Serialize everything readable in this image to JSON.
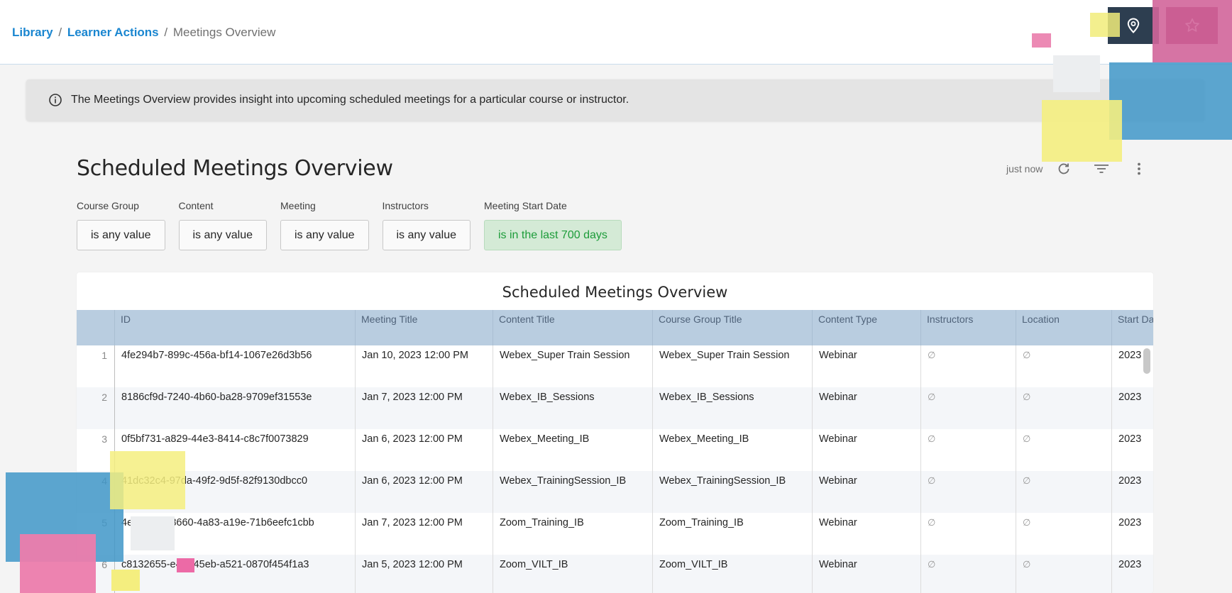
{
  "breadcrumb": {
    "library": "Library",
    "learner_actions": "Learner Actions",
    "current": "Meetings Overview",
    "separator": "/"
  },
  "topbar": {
    "pin_icon": "location-pin-icon",
    "star_icon": "star-icon",
    "pin_button_color": "#2d3e50",
    "star_button_color": "#8f1f52"
  },
  "info_banner": {
    "icon": "info-circle-icon",
    "text": "The Meetings Overview provides insight into upcoming scheduled meetings for a particular course or instructor."
  },
  "dashboard": {
    "title": "Scheduled Meetings Overview",
    "last_updated": "just now",
    "tools": [
      "refresh-icon",
      "filter-icon",
      "more-vertical-icon"
    ]
  },
  "filters": [
    {
      "label": "Course Group",
      "value": "is any value",
      "active": false
    },
    {
      "label": "Content",
      "value": "is any value",
      "active": false
    },
    {
      "label": "Meeting",
      "value": "is any value",
      "active": false
    },
    {
      "label": "Instructors",
      "value": "is any value",
      "active": false
    },
    {
      "label": "Meeting Start Date",
      "value": "is in the last 700 days",
      "active": true
    }
  ],
  "table": {
    "title": "Scheduled Meetings Overview",
    "columns": [
      "",
      "ID",
      "Meeting Title",
      "Content Title",
      "Course Group Title",
      "Content Type",
      "Instructors",
      "Location",
      "Start Da"
    ],
    "rows": [
      [
        "1",
        "4fe294b7-899c-456a-bf14-1067e26d3b56",
        "Jan 10, 2023 12:00 PM",
        "Webex_Super Train Session",
        "Webex_Super Train Session",
        "Webinar",
        "∅",
        "∅",
        "2023"
      ],
      [
        "2",
        "8186cf9d-7240-4b60-ba28-9709ef31553e",
        "Jan 7, 2023 12:00 PM",
        "Webex_IB_Sessions",
        "Webex_IB_Sessions",
        "Webinar",
        "∅",
        "∅",
        "2023"
      ],
      [
        "3",
        "0f5bf731-a829-44e3-8414-c8c7f0073829",
        "Jan 6, 2023 12:00 PM",
        "Webex_Meeting_IB",
        "Webex_Meeting_IB",
        "Webinar",
        "∅",
        "∅",
        "2023"
      ],
      [
        "4",
        "41dc32c4-97da-49f2-9d5f-82f9130dbcc0",
        "Jan 6, 2023 12:00 PM",
        "Webex_TrainingSession_IB",
        "Webex_TrainingSession_IB",
        "Webinar",
        "∅",
        "∅",
        "2023"
      ],
      [
        "5",
        "4e7a8d84-8660-4a83-a19e-71b6eefc1cbb",
        "Jan 7, 2023 12:00 PM",
        "Zoom_Training_IB",
        "Zoom_Training_IB",
        "Webinar",
        "∅",
        "∅",
        "2023"
      ],
      [
        "6",
        "c8132655-e48f-45eb-a521-0870f454f1a3",
        "Jan 5, 2023 12:00 PM",
        "Zoom_VILT_IB",
        "Zoom_VILT_IB",
        "Webinar",
        "∅",
        "∅",
        "2023"
      ]
    ]
  },
  "colors": {
    "link": "#1a86d0",
    "active_filter_text": "#1d9c3a",
    "active_filter_bg": "#d4ead6",
    "table_header_bg": "#b9cde0"
  }
}
